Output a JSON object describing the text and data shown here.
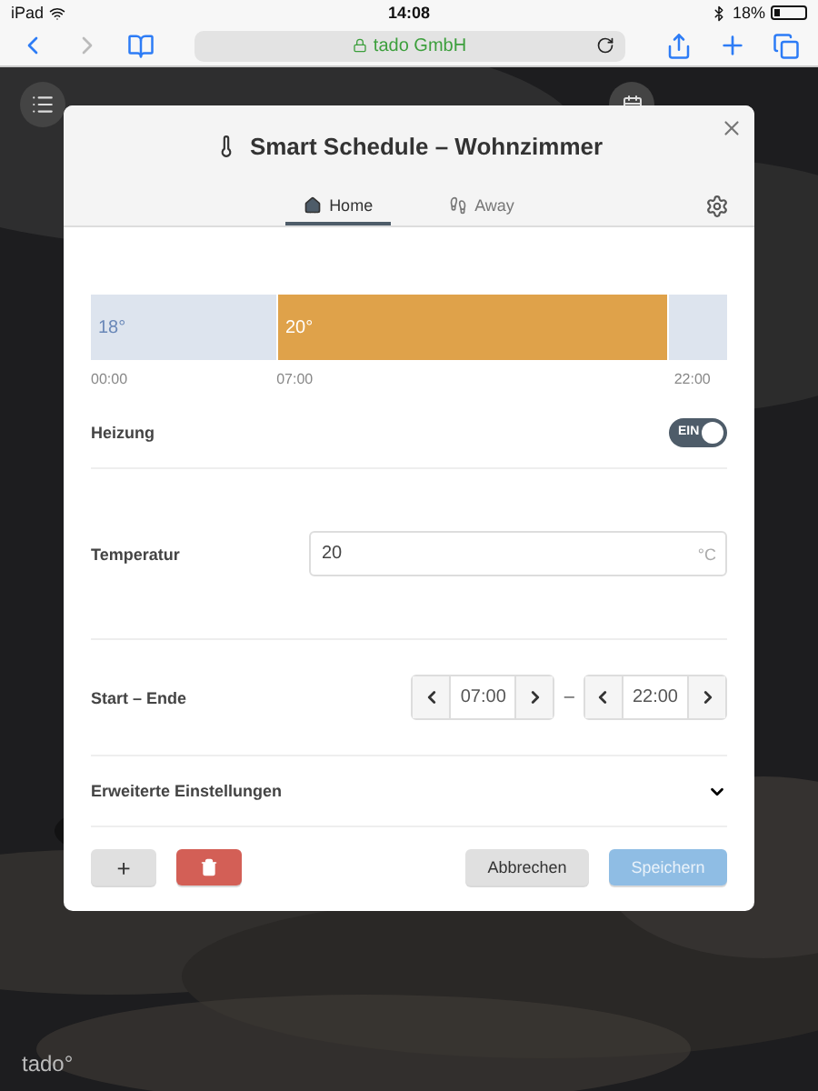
{
  "status_bar": {
    "device": "iPad",
    "time": "14:08",
    "battery": "18%"
  },
  "browser": {
    "url": "tado GmbH",
    "back_enabled": true,
    "forward_enabled": false
  },
  "dialog": {
    "title": "Smart Schedule – Wohnzimmer",
    "tabs": [
      {
        "label": "Home",
        "selected": true
      },
      {
        "label": "Away",
        "selected": false
      }
    ],
    "schedule": {
      "segments": [
        {
          "label": "18°",
          "color": "#dde4ee"
        },
        {
          "label": "20°",
          "color": "#dfa24a"
        },
        {
          "color": "#dde4ee"
        }
      ],
      "ticks": [
        "00:00",
        "07:00",
        "22:00"
      ]
    },
    "heating": {
      "label": "Heizung",
      "toggle_text": "EIN",
      "on": true
    },
    "temperature": {
      "label": "Temperatur",
      "value": "20",
      "unit": "°C"
    },
    "time_range": {
      "label": "Start – Ende",
      "start": "07:00",
      "separator": "–",
      "end": "22:00"
    },
    "advanced": {
      "label": "Erweiterte Einstellungen",
      "expanded": false
    },
    "buttons": {
      "add": "+",
      "cancel": "Abbrechen",
      "save": "Speichern"
    }
  },
  "logo": "tado°"
}
